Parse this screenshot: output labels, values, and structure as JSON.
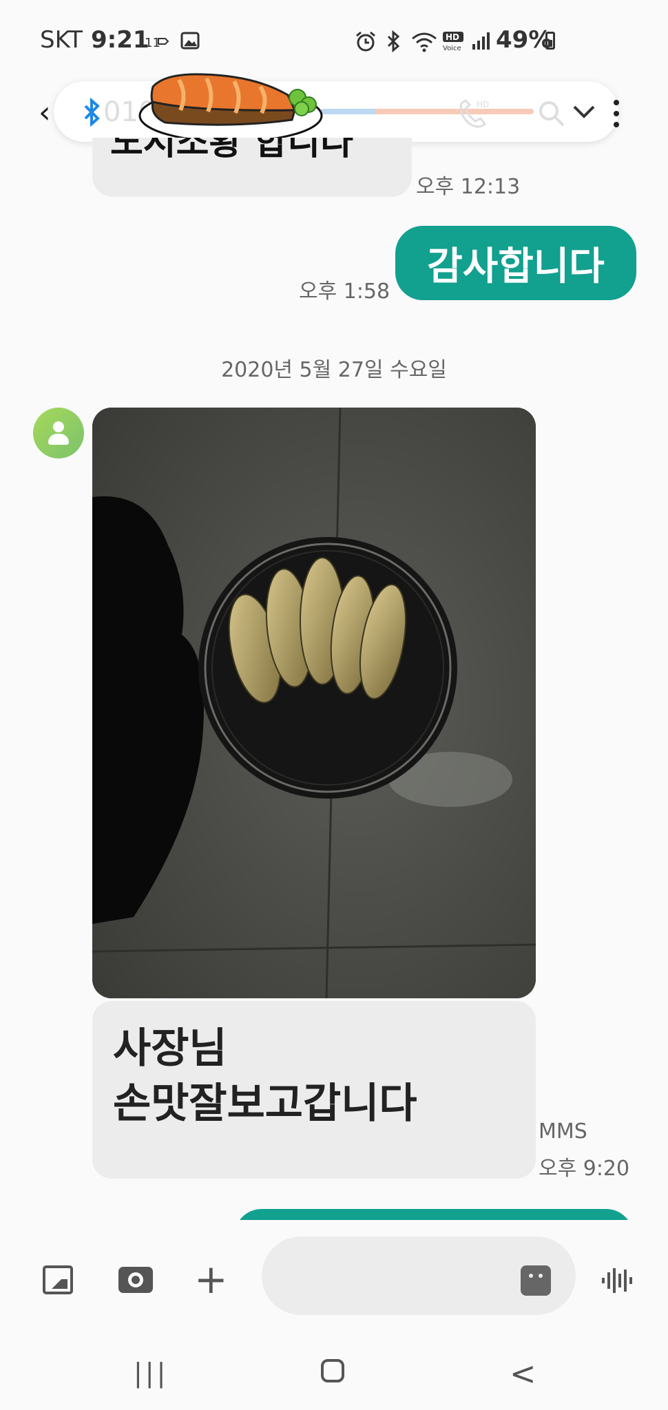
{
  "status_bar": {
    "carrier": "SKT",
    "time": "9:21",
    "notif_icons": [
      "signal-indicator-icon",
      "gallery-notification-icon"
    ],
    "system_icons": [
      "alarm-icon",
      "bluetooth-icon",
      "wifi-icon",
      "hd-voice-icon",
      "signal-bars-icon"
    ],
    "battery": "49%"
  },
  "header": {
    "back_icon": "back-arrow-icon",
    "contact_number_partial": "010",
    "call_progress": 0.26,
    "icons": [
      "bluetooth-icon",
      "phone-hd-icon",
      "search-icon",
      "expand-icon",
      "more-icon"
    ]
  },
  "messages": {
    "partial_received_text": "도시조황 합니다",
    "partial_received_time": "오후 12:13",
    "sent_text": "감사합니다",
    "sent_time": "오후 1:58",
    "date_divider": "2020년 5월 27일 수요일",
    "mms_line1": "사장님",
    "mms_line2": "손맛잘보고갑니다",
    "mms_type": "MMS",
    "mms_time": "오후 9:20"
  },
  "composer": {
    "icons": [
      "gallery-icon",
      "camera-icon",
      "plus-icon",
      "sticker-icon",
      "voice-icon"
    ],
    "placeholder": ""
  },
  "nav_bar": {
    "icons": [
      "recent-apps-icon",
      "home-icon",
      "back-icon"
    ]
  },
  "colors": {
    "accent": "#12a08f",
    "bubble_in": "#ececec",
    "background": "#fafafa"
  }
}
